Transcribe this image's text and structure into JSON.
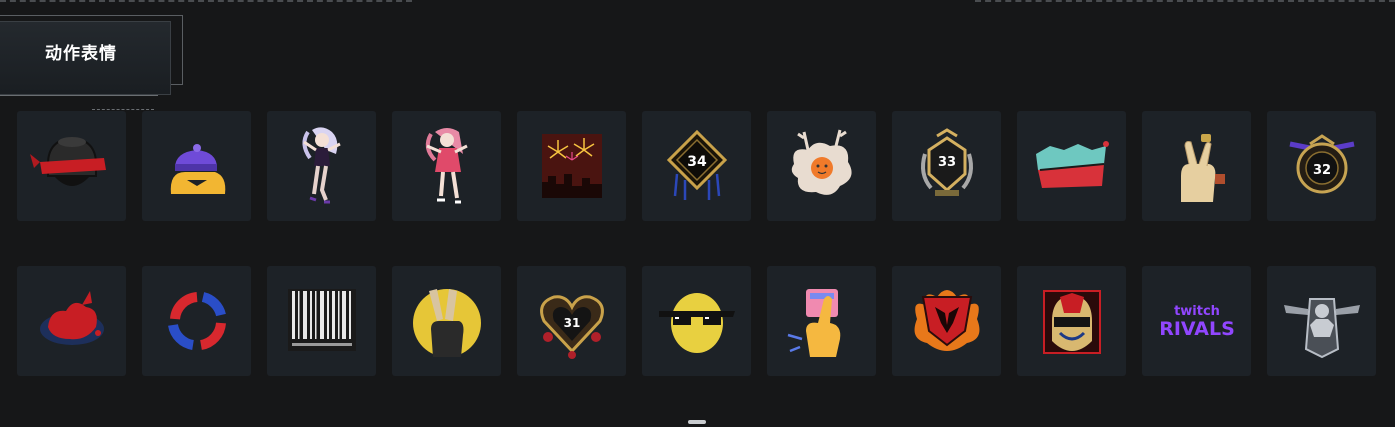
{
  "section": {
    "title": "动作表情"
  },
  "twitch_rivals": {
    "line1": "twitch",
    "line2": "RIVALS"
  },
  "colors": {
    "background": "#161718",
    "tile": "#1d2227"
  },
  "emotes": [
    "helmet-red-bandana-icon",
    "yellow-duck-beanie-icon",
    "anime-girl-white-hair-icon",
    "anime-girl-pink-hair-icon",
    "fireworks-city-icon",
    "rank-34-badge-icon",
    "egg-antlers-icon",
    "rank-33-badge-icon",
    "graffiti-word-icon",
    "finger-heart-icon",
    "rank-32-badge-icon",
    "red-splash-icon",
    "red-blue-ring-icon",
    "barcode-prisoner-icon",
    "peace-hand-glove-icon",
    "rank-31-heart-badge-icon",
    "lemon-sunglasses-icon",
    "pointing-hand-icon",
    "flaming-tiger-emblem-icon",
    "helmet-mask-icon",
    "twitch-rivals-icon",
    "statue-emblem-icon"
  ]
}
